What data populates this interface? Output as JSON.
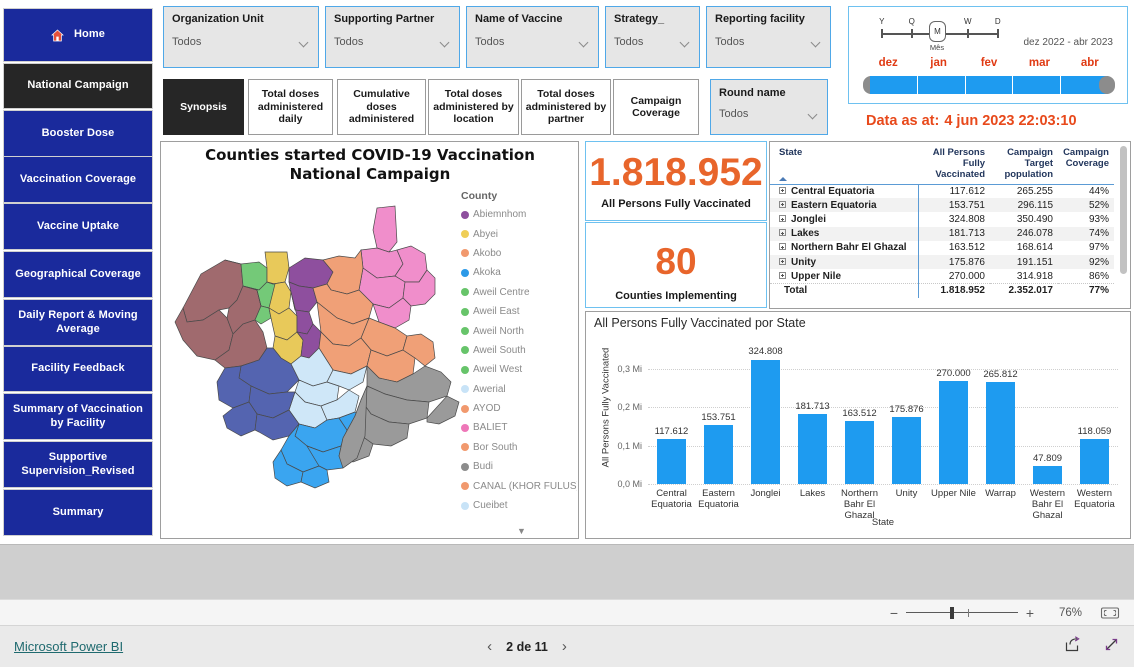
{
  "sidebar": {
    "items": [
      {
        "label": "Home",
        "icon": "home-icon",
        "active": false
      },
      {
        "label": "National Campaign",
        "active": true
      },
      {
        "label": "Booster Dose",
        "active": false
      },
      {
        "label": "Vaccination Coverage",
        "active": false
      },
      {
        "label": "Vaccine Uptake",
        "active": false
      },
      {
        "label": "Geographical Coverage",
        "active": false
      },
      {
        "label": "Daily Report & Moving Average",
        "active": false
      },
      {
        "label": "Facility Feedback",
        "active": false
      },
      {
        "label": "Summary of Vaccination by Facility",
        "active": false
      },
      {
        "label": "Supportive Supervision_Revised",
        "active": false
      },
      {
        "label": "Summary",
        "active": false
      }
    ]
  },
  "slicers": [
    {
      "title": "Organization Unit",
      "value": "Todos"
    },
    {
      "title": "Supporting Partner",
      "value": "Todos"
    },
    {
      "title": "Name of Vaccine",
      "value": "Todos"
    },
    {
      "title": "Strategy_",
      "value": "Todos"
    },
    {
      "title": "Reporting facility",
      "value": "Todos"
    }
  ],
  "round_slicer": {
    "title": "Round name",
    "value": "Todos"
  },
  "page_buttons": [
    {
      "label": "Synopsis",
      "active": true
    },
    {
      "label": "Total doses administered daily",
      "active": false
    },
    {
      "label": "Cumulative doses administered",
      "active": false
    },
    {
      "label": "Total doses administered by location",
      "active": false
    },
    {
      "label": "Total doses administered by partner",
      "active": false
    },
    {
      "label": "Campaign Coverage",
      "active": false
    }
  ],
  "date_slicer": {
    "granularities": [
      "Y",
      "Q",
      "M",
      "W",
      "D"
    ],
    "selected_granularity": "M",
    "granularity_sublabel": "Mês",
    "range_text": "dez 2022 - abr 2023",
    "months": [
      "dez",
      "jan",
      "fev",
      "mar",
      "abr"
    ]
  },
  "data_as_at": {
    "label": "Data as at:",
    "value": "4 jun 2023 22:03:10"
  },
  "map_visual": {
    "title": "Counties started COVID-19 Vaccination National Campaign",
    "legend_title": "County",
    "legend": [
      {
        "label": "Abiemnhom",
        "color": "#8e4f9e"
      },
      {
        "label": "Abyei",
        "color": "#efce57"
      },
      {
        "label": "Akobo",
        "color": "#f1996e"
      },
      {
        "label": "Akoka",
        "color": "#2c9ae8"
      },
      {
        "label": "Aweil Centre",
        "color": "#67c46a"
      },
      {
        "label": "Aweil East",
        "color": "#67c46a"
      },
      {
        "label": "Aweil North",
        "color": "#67c46a"
      },
      {
        "label": "Aweil South",
        "color": "#67c46a"
      },
      {
        "label": "Aweil West",
        "color": "#67c46a"
      },
      {
        "label": "Awerial",
        "color": "#c8e3f7"
      },
      {
        "label": "AYOD",
        "color": "#f1996e"
      },
      {
        "label": "BALIET",
        "color": "#ee77b8"
      },
      {
        "label": "Bor South",
        "color": "#f1996e"
      },
      {
        "label": "Budi",
        "color": "#8c8c8c"
      },
      {
        "label": "CANAL (KHOR FULUS)",
        "color": "#f1996e"
      },
      {
        "label": "Cueibet",
        "color": "#c8e3f7"
      }
    ],
    "scroll_icon": "chevron-down-icon"
  },
  "kpis": [
    {
      "value": "1.818.952",
      "label": "All Persons Fully Vaccinated"
    },
    {
      "value": "80",
      "label": "Counties Implementing"
    }
  ],
  "matrix": {
    "columns": [
      "State",
      "All Persons Fully Vaccinated",
      "Campaign Target population",
      "Campaign Coverage"
    ],
    "rows": [
      {
        "state": "Central Equatoria",
        "vaccinated": "117.612",
        "target": "265.255",
        "coverage": "44%"
      },
      {
        "state": "Eastern Equatoria",
        "vaccinated": "153.751",
        "target": "296.115",
        "coverage": "52%"
      },
      {
        "state": "Jonglei",
        "vaccinated": "324.808",
        "target": "350.490",
        "coverage": "93%"
      },
      {
        "state": "Lakes",
        "vaccinated": "181.713",
        "target": "246.078",
        "coverage": "74%"
      },
      {
        "state": "Northern Bahr El Ghazal",
        "vaccinated": "163.512",
        "target": "168.614",
        "coverage": "97%"
      },
      {
        "state": "Unity",
        "vaccinated": "175.876",
        "target": "191.151",
        "coverage": "92%"
      },
      {
        "state": "Upper Nile",
        "vaccinated": "270.000",
        "target": "314.918",
        "coverage": "86%"
      }
    ],
    "total": {
      "state": "Total",
      "vaccinated": "1.818.952",
      "target": "2.352.017",
      "coverage": "77%"
    }
  },
  "chart_data": {
    "type": "bar",
    "title": "All Persons Fully Vaccinated por State",
    "xlabel": "State",
    "ylabel": "All Persons Fully Vaccinated",
    "categories": [
      "Central Equatoria",
      "Eastern Equatoria",
      "Jonglei",
      "Lakes",
      "Northern Bahr El Ghazal",
      "Unity",
      "Upper Nile",
      "Warrap",
      "Western Bahr El Ghazal",
      "Western Equatoria"
    ],
    "values": [
      117612,
      153751,
      324808,
      181713,
      163512,
      175876,
      270000,
      265812,
      47809,
      118059
    ],
    "data_labels": [
      "117.612",
      "153.751",
      "324.808",
      "181.713",
      "163.512",
      "175.876",
      "270.000",
      "265.812",
      "47.809",
      "118.059"
    ],
    "ytick_labels": [
      "0,0 Mi",
      "0,1 Mi",
      "0,2 Mi",
      "0,3 Mi"
    ],
    "ytick_values": [
      0,
      100000,
      200000,
      300000
    ],
    "ylim": [
      0,
      360000
    ],
    "grid": true,
    "legend": "none",
    "bar_color": "#1e9bf0"
  },
  "status_bar": {
    "zoom_percent": "76%",
    "minus": "−",
    "plus": "+",
    "fit_icon": "fit-to-page-icon"
  },
  "footer": {
    "brand": "Microsoft Power BI",
    "prev_icon": "chevron-left-icon",
    "next_icon": "chevron-right-icon",
    "page_text": "2 de 11",
    "share_icon": "share-icon",
    "fullscreen_icon": "fullscreen-icon"
  }
}
